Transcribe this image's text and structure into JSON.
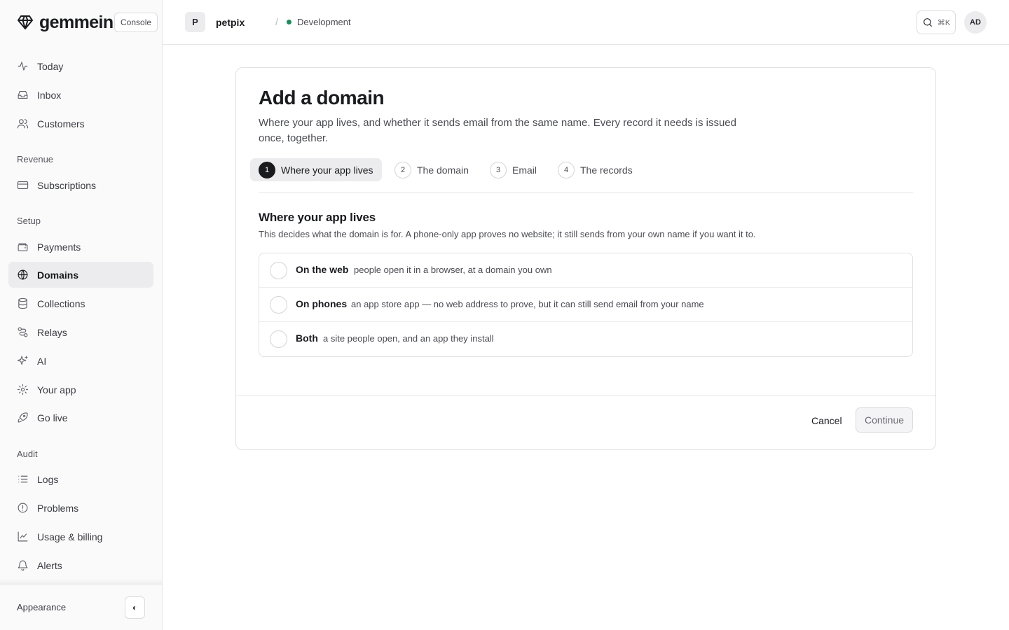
{
  "brand": {
    "name": "gemmein",
    "badge": "Console"
  },
  "sidebar": {
    "items": [
      {
        "label": "Today",
        "icon": "activity-icon"
      },
      {
        "label": "Inbox",
        "icon": "inbox-icon"
      },
      {
        "label": "Customers",
        "icon": "users-icon"
      }
    ],
    "revenue": {
      "label": "Revenue",
      "items": [
        {
          "label": "Subscriptions",
          "icon": "credit-card-icon"
        }
      ]
    },
    "setup": {
      "label": "Setup",
      "items": [
        {
          "label": "Payments",
          "icon": "wallet-icon"
        },
        {
          "label": "Domains",
          "icon": "globe-icon",
          "active": true
        },
        {
          "label": "Collections",
          "icon": "database-icon"
        },
        {
          "label": "Relays",
          "icon": "route-icon"
        },
        {
          "label": "AI",
          "icon": "sparkles-icon"
        },
        {
          "label": "Your app",
          "icon": "gear-icon"
        },
        {
          "label": "Go live",
          "icon": "rocket-icon"
        }
      ]
    },
    "audit": {
      "label": "Audit",
      "items": [
        {
          "label": "Logs",
          "icon": "list-icon"
        },
        {
          "label": "Problems",
          "icon": "alert-circle-icon"
        },
        {
          "label": "Usage & billing",
          "icon": "chart-icon"
        },
        {
          "label": "Alerts",
          "icon": "bell-icon"
        }
      ]
    },
    "footer": {
      "appearance_label": "Appearance",
      "toggle_glyph": "◐"
    }
  },
  "topbar": {
    "project_initial": "P",
    "project_name": "petpix",
    "separator": "/",
    "environment": "Development",
    "environment_color": "#1f8a5b",
    "search_shortcut": "⌘K",
    "user_initials": "AD"
  },
  "card": {
    "title": "Add a domain",
    "subtitle": "Where your app lives, and whether it sends email from the same name. Every record it needs is issued once, together.",
    "steps": [
      {
        "num": "1",
        "label": "Where your app lives",
        "active": true
      },
      {
        "num": "2",
        "label": "The domain"
      },
      {
        "num": "3",
        "label": "Email"
      },
      {
        "num": "4",
        "label": "The records"
      }
    ],
    "section_title": "Where your app lives",
    "section_desc": "This decides what the domain is for. A phone-only app proves no website; it still sends from your own name if you want it to.",
    "options": [
      {
        "title": "On the web",
        "desc": "people open it in a browser, at a domain you own"
      },
      {
        "title": "On phones",
        "desc": "an app store app — no web address to prove, but it can still send email from your name"
      },
      {
        "title": "Both",
        "desc": "a site people open, and an app they install"
      }
    ],
    "cancel_label": "Cancel",
    "continue_label": "Continue"
  }
}
